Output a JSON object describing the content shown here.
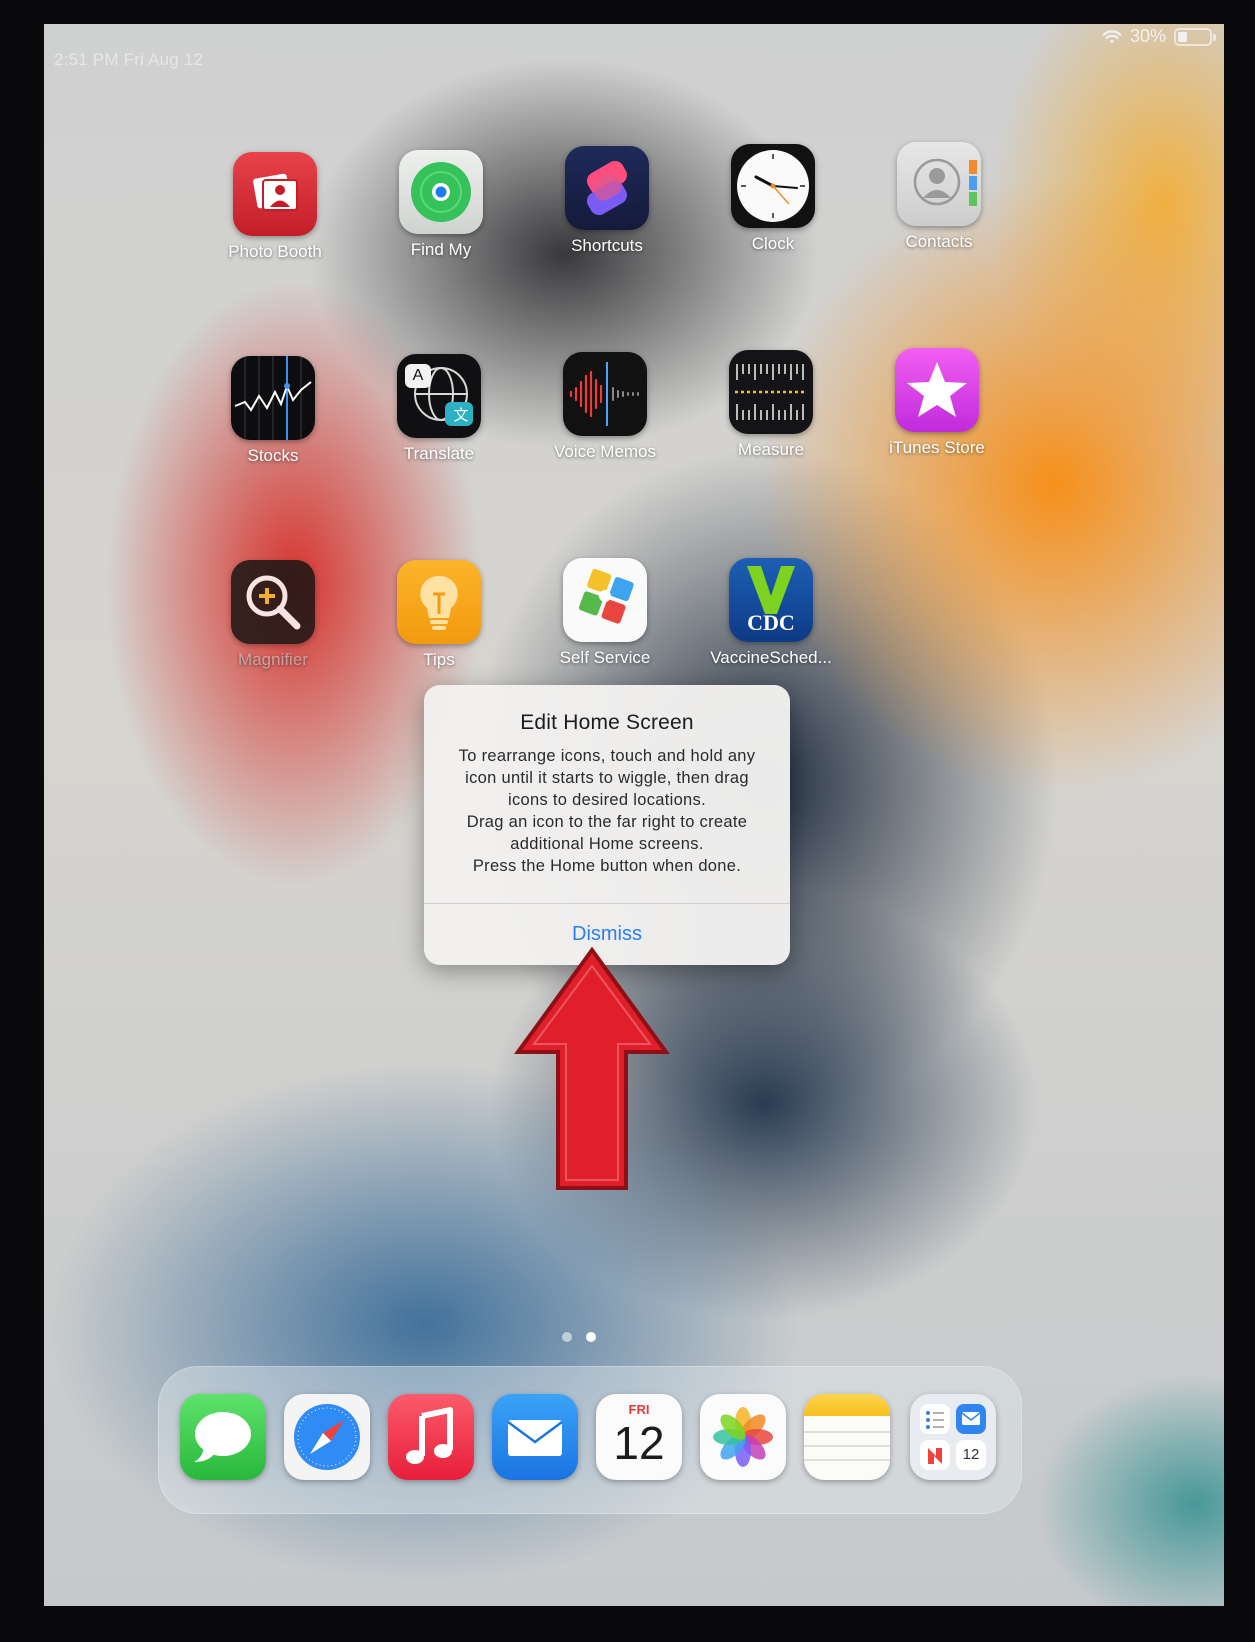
{
  "status_bar": {
    "time_date": "2:51 PM   Fri Aug 12",
    "battery_percent": "30%",
    "battery_level": 0.3
  },
  "apps": [
    {
      "label": "Photo Booth"
    },
    {
      "label": "Find My"
    },
    {
      "label": "Shortcuts"
    },
    {
      "label": "Clock"
    },
    {
      "label": "Contacts"
    },
    {
      "label": "Stocks"
    },
    {
      "label": "Translate"
    },
    {
      "label": "Voice Memos"
    },
    {
      "label": "Measure"
    },
    {
      "label": "iTunes Store"
    },
    {
      "label": "Magnifier"
    },
    {
      "label": "Tips"
    },
    {
      "label": "Self Service"
    },
    {
      "label": "VaccineSched..."
    }
  ],
  "icon_text": {
    "translate_a": "A",
    "cdc": "CDC",
    "calendar_day": "FRI",
    "calendar_date": "12",
    "mini_calendar_date": "12"
  },
  "dialog": {
    "title": "Edit Home Screen",
    "lines": [
      "To rearrange icons, touch and hold any",
      "icon until it starts to wiggle, then drag",
      "icons to desired locations.",
      "Drag an icon to the far right to create",
      "additional Home screens.",
      "Press the Home button when done."
    ],
    "dismiss_label": "Dismiss"
  },
  "page_indicator": {
    "pages": 2,
    "current": 2
  },
  "dock": [
    {
      "icon": "messages-icon"
    },
    {
      "icon": "safari-icon"
    },
    {
      "icon": "music-icon"
    },
    {
      "icon": "mail-icon"
    },
    {
      "icon": "calendar-icon"
    },
    {
      "icon": "photos-icon"
    },
    {
      "icon": "notes-icon"
    },
    {
      "icon": "app-library-icon"
    }
  ],
  "colors": {
    "accent": "#2a7ef0",
    "annotation_arrow": "#e11f2a"
  }
}
